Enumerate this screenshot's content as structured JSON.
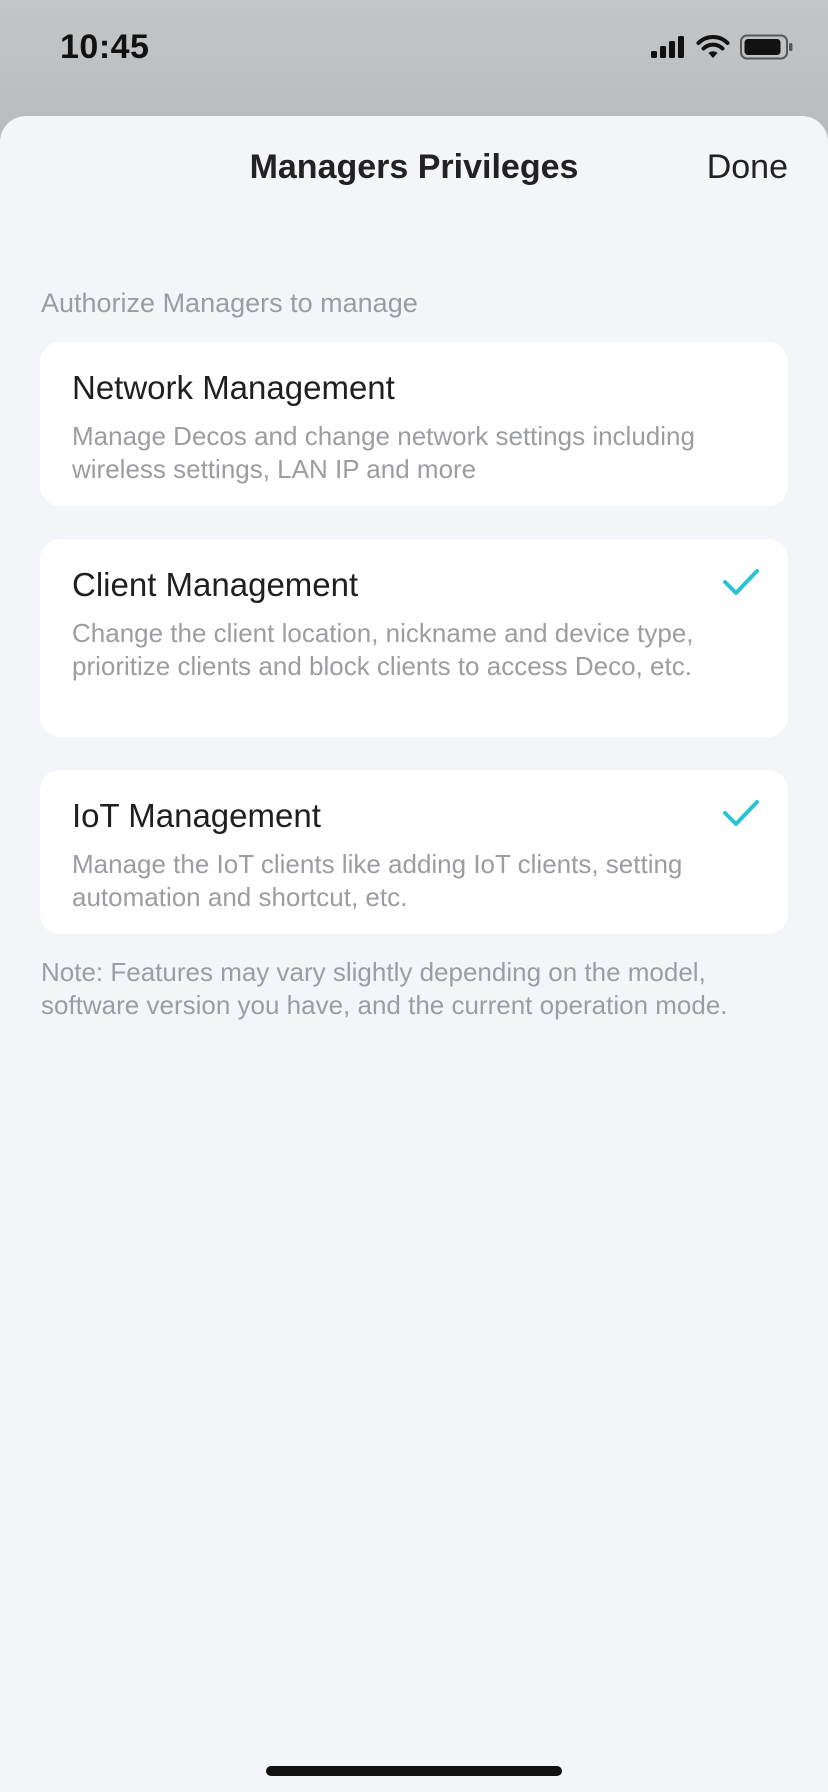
{
  "status_bar": {
    "time": "10:45",
    "icons": [
      "cellular-signal-icon",
      "wifi-icon",
      "battery-icon"
    ]
  },
  "header": {
    "title": "Managers Privileges",
    "done_label": "Done"
  },
  "section": {
    "header": "Authorize Managers to manage"
  },
  "privileges": [
    {
      "title": "Network Management",
      "description": "Manage Decos and change network settings including wireless settings, LAN IP and more",
      "checked": false
    },
    {
      "title": "Client Management",
      "description": "Change the client location, nickname and device type, prioritize clients and block clients to access Deco, etc.",
      "checked": true
    },
    {
      "title": "IoT Management",
      "description": "Manage the IoT clients like adding IoT clients, setting automation and shortcut, etc.",
      "checked": true
    }
  ],
  "note": "Note: Features may vary slightly depending on the model, software version you have, and the current operation mode.",
  "colors": {
    "accent": "#29c3d6",
    "sheet_background": "#f4f5f9",
    "card_background": "#ffffff",
    "secondary_text": "#9b9da2"
  }
}
